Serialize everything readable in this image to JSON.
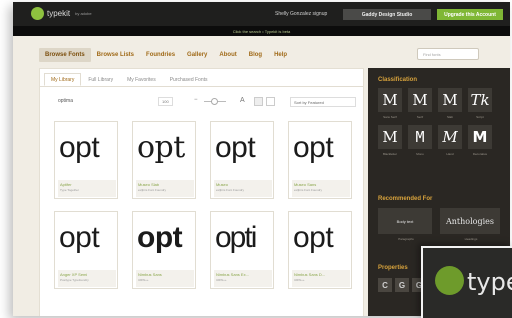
{
  "topbar": {
    "logo": "typekit",
    "logo_sub": "by adobe",
    "user": "Shelly Gonzalez signup",
    "studio_button": "Gaddy Design Studio",
    "upgrade_button": "Upgrade this Account"
  },
  "announcement": "Click the search • Typekit is beta",
  "nav": {
    "items": [
      "Browse Fonts",
      "Browse Lists",
      "Foundries",
      "Gallery",
      "About",
      "Blog",
      "Help"
    ],
    "search_placeholder": "Find fonts"
  },
  "library": {
    "tabs": [
      "My Library",
      "Full Library",
      "My Favorites",
      "Purchased Fonts"
    ],
    "sample_text_label": "optima",
    "size_value": "100",
    "sort_label": "Sort by Featured"
  },
  "cards": [
    {
      "sample": "opt",
      "name": "Aptifer",
      "foundry": "Type Together"
    },
    {
      "sample": "opt",
      "name": "Museo Slab",
      "foundry": "exljbris Font Foundry"
    },
    {
      "sample": "opt",
      "name": "Museo",
      "foundry": "exljbris Font Foundry"
    },
    {
      "sample": "opt",
      "name": "Museo Sans",
      "foundry": "exljbris Font Foundry"
    },
    {
      "sample": "opt",
      "name": "Anger XP Semi",
      "foundry": "Positype Typefoundry"
    },
    {
      "sample": "opt",
      "name": "Nimbus Sans",
      "foundry": "URW++"
    },
    {
      "sample": "opti",
      "name": "Nimbus Sans Ex...",
      "foundry": "URW++"
    },
    {
      "sample": "opt",
      "name": "Nimbus Sans D...",
      "foundry": "URW++"
    }
  ],
  "sidebar": {
    "classification_title": "Classification",
    "classification": [
      {
        "glyph": "M",
        "label": "Sans Serif"
      },
      {
        "glyph": "M",
        "label": "Serif"
      },
      {
        "glyph": "M",
        "label": "Slab"
      },
      {
        "glyph": "Tk",
        "label": "Script"
      },
      {
        "glyph": "M",
        "label": "Blackletter"
      },
      {
        "glyph": "M",
        "label": "Mono"
      },
      {
        "glyph": "M",
        "label": "Hand"
      },
      {
        "glyph": "M",
        "label": "Decorative"
      }
    ],
    "recommended_title": "Recommended For",
    "recommended": [
      {
        "label": "Body text",
        "caption": "Paragraphs"
      },
      {
        "label": "Anthologies",
        "caption": "Headings"
      }
    ],
    "properties_title": "Properties",
    "properties": [
      "C",
      "G",
      "G"
    ]
  },
  "inset": {
    "text": "type"
  },
  "colors": {
    "accent": "#a06a18",
    "brand_green": "#7fb735",
    "sidebar_bg": "#2a2723"
  }
}
